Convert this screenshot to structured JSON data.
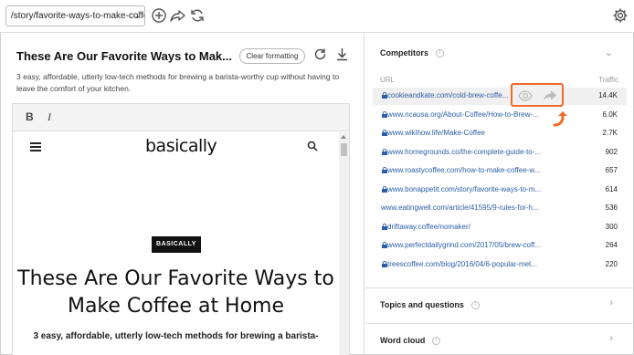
{
  "toolbar": {
    "url_value": "/story/favorite-ways-to-make-coffee..."
  },
  "doc": {
    "title": "These Are Our Favorite Ways to Mak...",
    "clear_label": "Clear formatting",
    "description": "3 easy, affordable, utterly low-tech methods for brewing a barista-worthy cup without having to leave the comfort of your kitchen."
  },
  "editor": {
    "bold": "B",
    "italic": "I"
  },
  "preview": {
    "brand": "basically",
    "tag": "BASICALLY",
    "headline_line1": "These Are Our Favorite Ways to",
    "headline_line2": "Make Coffee at Home",
    "subline": "3 easy, affordable, utterly low-tech methods for brewing a barista-"
  },
  "competitors": {
    "title": "Competitors",
    "col_url": "URL",
    "col_traffic": "Traffic",
    "rows": [
      {
        "url": "cookieandkate.com/cold-brew-coffe...",
        "traffic": "14.4K",
        "lock": true
      },
      {
        "url": "www.ncausa.org/About-Coffee/How-to-Brew-...",
        "traffic": "6.0K",
        "lock": true
      },
      {
        "url": "www.wikihow.life/Make-Coffee",
        "traffic": "2.7K",
        "lock": true
      },
      {
        "url": "www.homegrounds.co/the-complete-guide-to-...",
        "traffic": "902",
        "lock": true
      },
      {
        "url": "www.roastycoffee.com/how-to-make-coffee-w...",
        "traffic": "657",
        "lock": true
      },
      {
        "url": "www.bonappetit.com/story/favorite-ways-to-m...",
        "traffic": "614",
        "lock": true
      },
      {
        "url": "www.eatingwell.com/article/41595/9-rules-for-h...",
        "traffic": "536",
        "lock": false
      },
      {
        "url": "driftaway.coffee/nomaker/",
        "traffic": "300",
        "lock": true
      },
      {
        "url": "www.perfectdailygrind.com/2017/05/brew-coff...",
        "traffic": "264",
        "lock": true
      },
      {
        "url": "treescoffee.com/blog/2016/04/6-popular-met...",
        "traffic": "220",
        "lock": true
      }
    ]
  },
  "topics": {
    "title": "Topics and questions"
  },
  "wordcloud": {
    "title": "Word cloud"
  },
  "colors": {
    "accent": "#f26a2a",
    "link": "#2b5ea8"
  }
}
